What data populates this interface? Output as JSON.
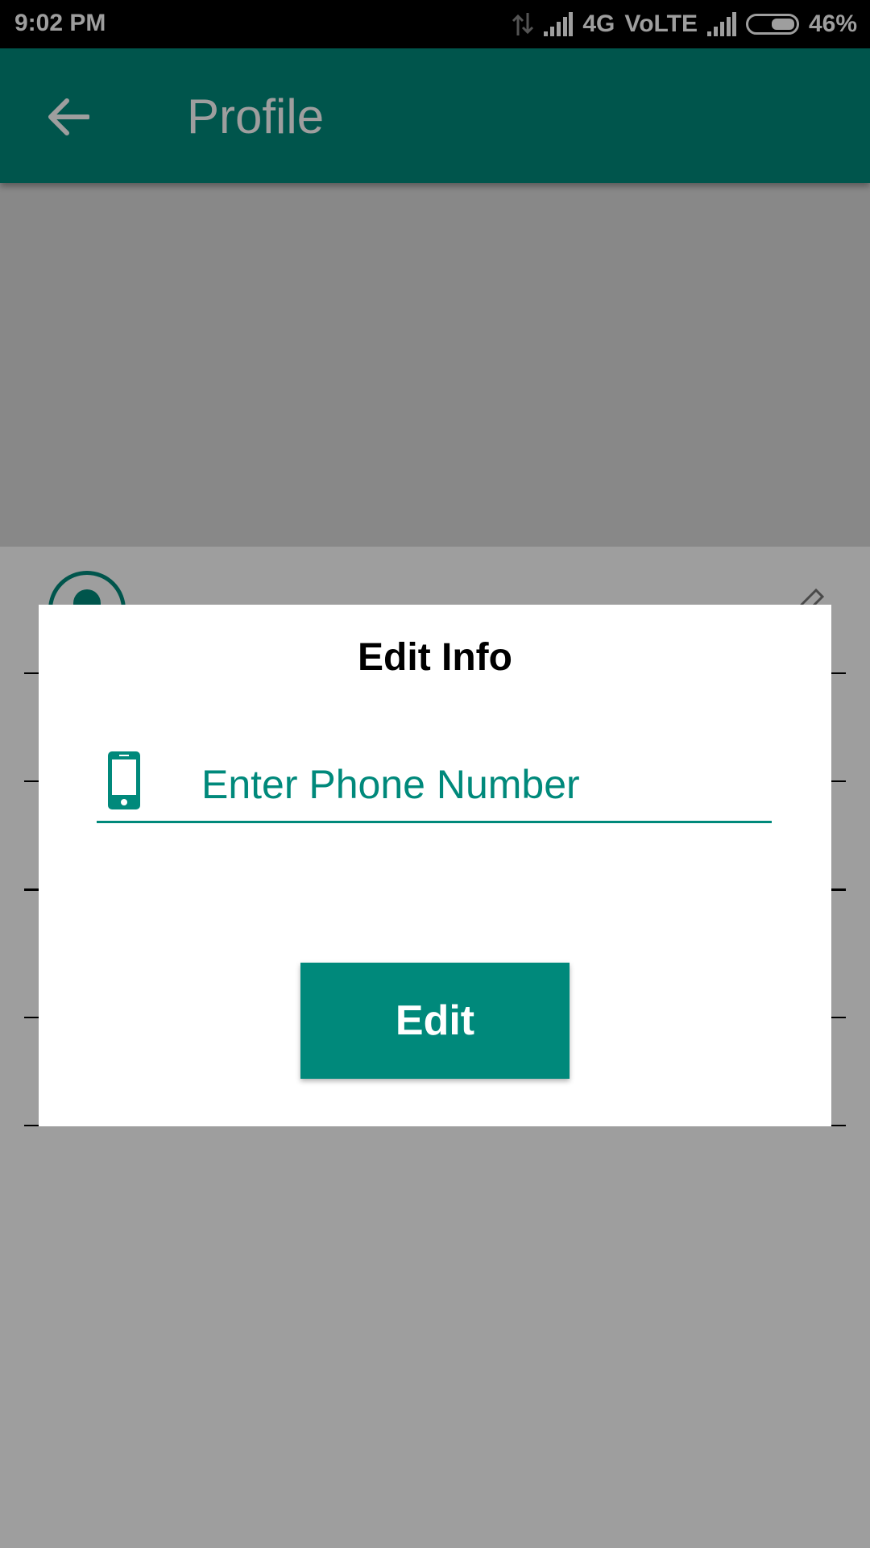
{
  "status_bar": {
    "time": "9:02 PM",
    "network": "4G",
    "volte": "VoLTE",
    "battery": "46%"
  },
  "app_bar": {
    "title": "Profile",
    "back_icon": "arrow-back-icon",
    "color": "#00897b"
  },
  "dialog": {
    "title": "Edit Info",
    "phone_placeholder": "Enter Phone Number",
    "phone_icon": "smartphone-icon",
    "button_label": "Edit"
  },
  "colors": {
    "accent": "#00897b",
    "scrim": "rgba(0,0,0,0.38)"
  }
}
